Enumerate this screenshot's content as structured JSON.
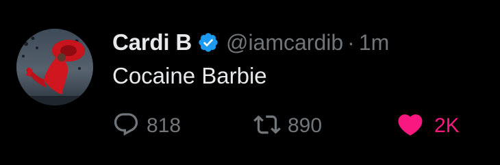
{
  "tweet": {
    "author": {
      "display_name": "Cardi B",
      "handle": "@iamcardib",
      "verified": true
    },
    "separator": "·",
    "timestamp": "1m",
    "text": "Cocaine Barbie",
    "actions": {
      "replies": "818",
      "retweets": "890",
      "likes": "2K",
      "liked": true
    }
  },
  "icons": {
    "verified": "verified-badge-icon",
    "reply": "reply-icon",
    "retweet": "retweet-icon",
    "like": "heart-icon"
  },
  "colors": {
    "background": "#000000",
    "text_primary": "#e7e9ea",
    "text_secondary": "#71767b",
    "verified_blue": "#1d9bf0",
    "like_pink": "#f91880"
  }
}
